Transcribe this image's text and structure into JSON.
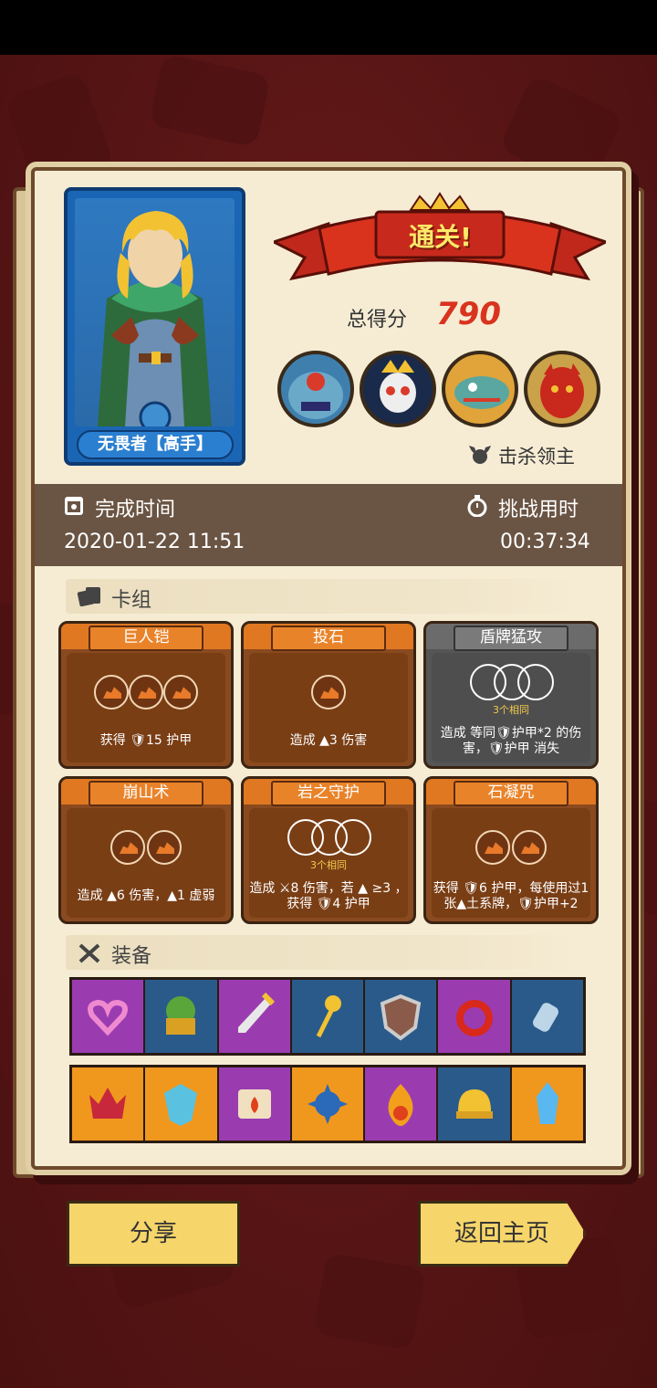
{
  "result": {
    "banner": "通关!",
    "score_label": "总得分",
    "score_value": "790",
    "kill_boss_label": "击杀领主"
  },
  "hero": {
    "name": "无畏者【高手】"
  },
  "stats": {
    "finish_time_label": "完成时间",
    "finish_time_value": "2020-01-22 11:51",
    "challenge_time_label": "挑战用时",
    "challenge_time_value": "00:37:34"
  },
  "deck": {
    "title": "卡组",
    "cards": [
      {
        "name": "巨人铠",
        "desc": "获得 🛡15 护甲",
        "style": "orange"
      },
      {
        "name": "投石",
        "desc": "造成 ▲3 伤害",
        "style": "orange"
      },
      {
        "name": "盾牌猛攻",
        "same": "3个相同",
        "desc": "造成 等同🛡护甲*2 的伤害，🛡护甲 消失",
        "style": "gray"
      },
      {
        "name": "崩山术",
        "desc": "造成 ▲6 伤害，▲1 虚弱",
        "style": "orange"
      },
      {
        "name": "岩之守护",
        "same": "3个相同",
        "desc": "造成 ⚔8 伤害，若 ▲ ≥3 ，获得 🛡4 护甲",
        "style": "orange"
      },
      {
        "name": "石凝咒",
        "desc": "获得 🛡6 护甲，每使用过1张▲土系牌，🛡护甲+2",
        "style": "orange"
      }
    ]
  },
  "equipment": {
    "title": "装备",
    "row1": [
      {
        "icon": "heart-amulet-icon",
        "color": "purple"
      },
      {
        "icon": "treasure-tree-icon",
        "color": "blue"
      },
      {
        "icon": "golden-dagger-icon",
        "color": "purple"
      },
      {
        "icon": "moon-wand-icon",
        "color": "blue"
      },
      {
        "icon": "round-shield-icon",
        "color": "blue"
      },
      {
        "icon": "red-ring-icon",
        "color": "purple"
      },
      {
        "icon": "stone-charm-icon",
        "color": "blue"
      }
    ],
    "row2": [
      {
        "icon": "ruby-crown-icon",
        "color": "orange"
      },
      {
        "icon": "ice-crest-icon",
        "color": "orange"
      },
      {
        "icon": "fire-scroll-icon",
        "color": "purple"
      },
      {
        "icon": "spiked-orb-icon",
        "color": "orange"
      },
      {
        "icon": "flame-gem-icon",
        "color": "purple"
      },
      {
        "icon": "golden-helmet-icon",
        "color": "blue"
      },
      {
        "icon": "ice-crystal-icon",
        "color": "orange"
      }
    ]
  },
  "buttons": {
    "share": "分享",
    "home": "返回主页"
  },
  "colors": {
    "score": "#d9331e",
    "panel": "#f6ecd4",
    "background": "#5a1616"
  }
}
